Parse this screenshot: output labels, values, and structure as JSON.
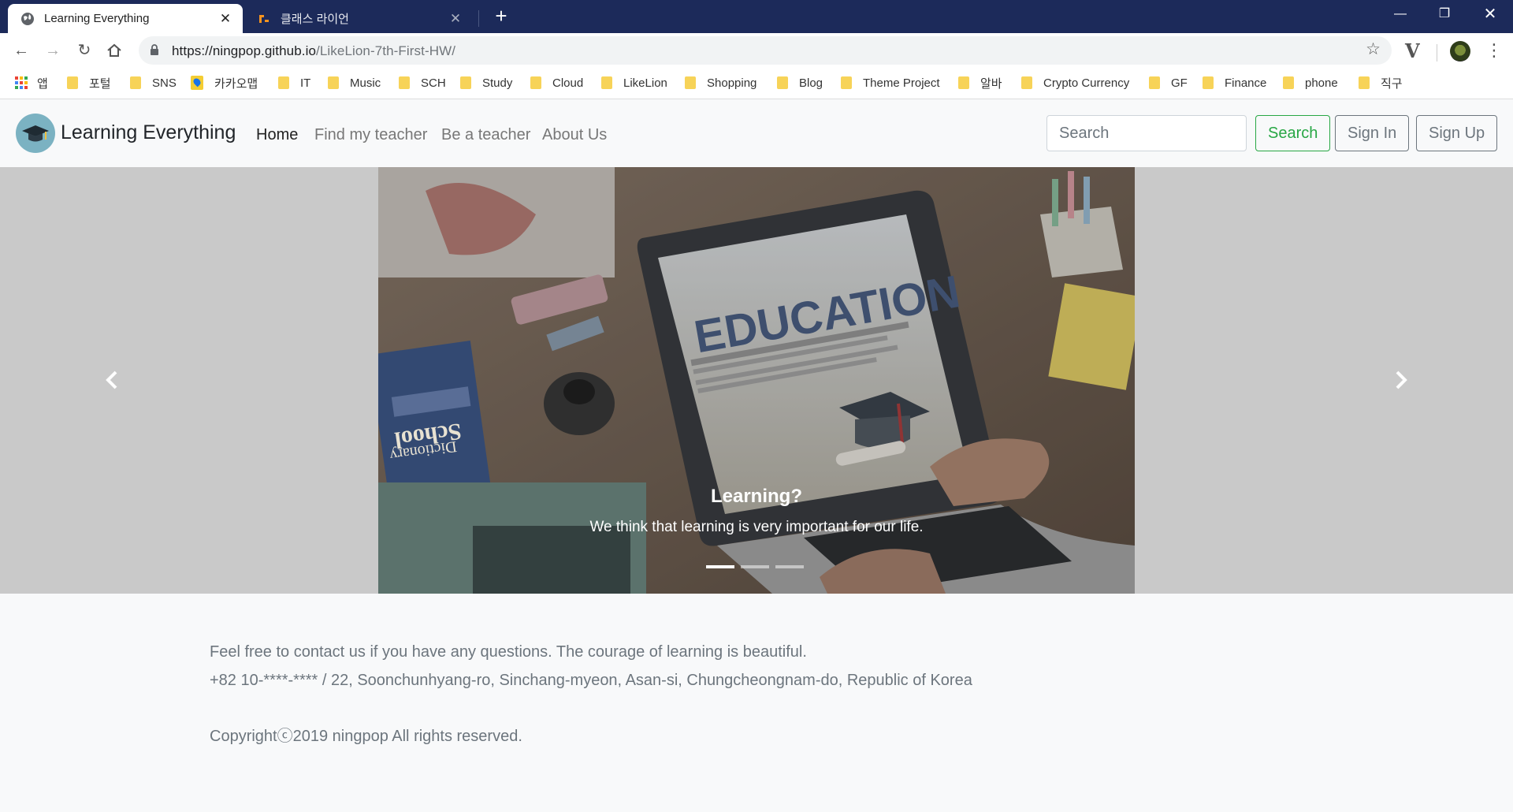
{
  "browser": {
    "tabs": [
      {
        "title": "Learning Everything",
        "active": true
      },
      {
        "title": "클래스 라이언",
        "active": false
      }
    ],
    "new_tab": "+",
    "window_controls": {
      "minimize": "—",
      "restore": "❐",
      "close": "✕"
    },
    "url_host": "https://ningpop.github.io",
    "url_path": "/LikeLion-7th-First-HW/",
    "bookmarks": [
      "앱",
      "포털",
      "SNS",
      "카카오맵",
      "IT",
      "Music",
      "SCH",
      "Study",
      "Cloud",
      "LikeLion",
      "Shopping",
      "Blog",
      "Theme Project",
      "알바",
      "Crypto Currency",
      "GF",
      "Finance",
      "phone",
      "직구"
    ]
  },
  "navbar": {
    "brand": "Learning Everything",
    "links": [
      "Home",
      "Find my teacher",
      "Be a teacher",
      "About Us"
    ],
    "active_link": "Home",
    "search_placeholder": "Search",
    "search_button": "Search",
    "sign_in": "Sign In",
    "sign_up": "Sign Up",
    "accent_color": "#28a745"
  },
  "carousel": {
    "image_text": "EDUCATION",
    "book_text_1": "School",
    "book_text_2": "Dictionary",
    "caption_title": "Learning?",
    "caption_text": "We think that learning is very important for our life.",
    "slides_count": 3,
    "active_slide": 1
  },
  "footer": {
    "line1": "Feel free to contact us if you have any questions. The courage of learning is beautiful.",
    "line2": "+82 10-****-**** / 22, Soonchunhyang-ro, Sinchang-myeon, Asan-si, Chungcheongnam-do, Republic of Korea",
    "copyright": "Copyrightⓒ2019 ningpop All rights reserved."
  }
}
